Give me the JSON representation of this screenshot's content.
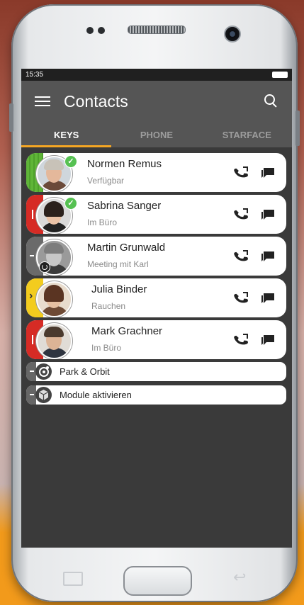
{
  "status_bar": {
    "time": "15:35"
  },
  "app_bar": {
    "title": "Contacts"
  },
  "tabs": [
    {
      "label": "KEYS",
      "active": true
    },
    {
      "label": "PHONE",
      "active": false
    },
    {
      "label": "STARFACE",
      "active": false
    }
  ],
  "contacts": [
    {
      "name": "Normen Remus",
      "status": "Verfügbar",
      "presence": "available",
      "stripe_color": "#5fb538",
      "checked": true
    },
    {
      "name": "Sabrina Sanger",
      "status": "Im Büro",
      "presence": "busy",
      "stripe_color": "#d62b25",
      "checked": true
    },
    {
      "name": "Martin Grunwald",
      "status": "Meeting mit Karl",
      "presence": "offline",
      "stripe_color": "#6a6a6a",
      "checked": false
    },
    {
      "name": "Julia Binder",
      "status": "Rauchen",
      "presence": "away",
      "stripe_color": "#f3cc1e",
      "checked": false
    },
    {
      "name": "Mark Grachner",
      "status": "Im Büro",
      "presence": "busy",
      "stripe_color": "#d62b25",
      "checked": false
    }
  ],
  "modules": [
    {
      "label": "Park & Orbit",
      "icon": "park-orbit-icon"
    },
    {
      "label": "Module aktivieren",
      "icon": "cube-icon"
    }
  ],
  "colors": {
    "accent": "#f5a623",
    "appbar": "#555555",
    "screen_bg": "#3a3a3a"
  }
}
